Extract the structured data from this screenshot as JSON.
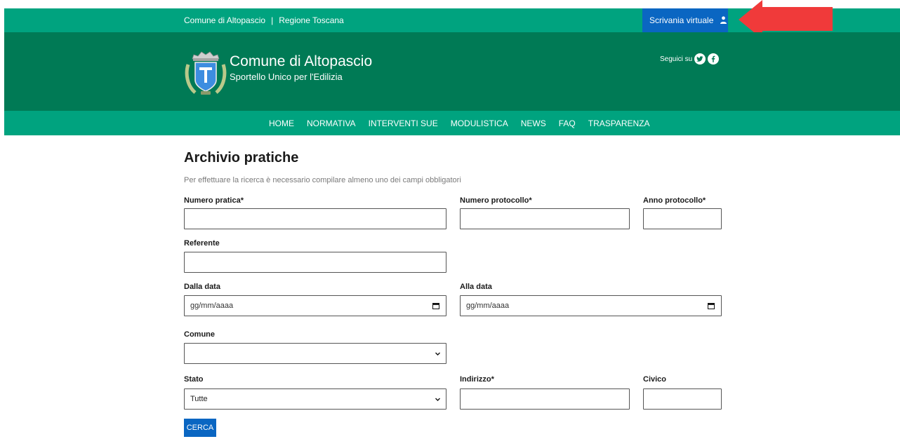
{
  "topbar": {
    "link_comune": "Comune di Altopascio",
    "separator": "|",
    "link_regione": "Regione Toscana",
    "scrivania_label": "Scrivania virtuale"
  },
  "header": {
    "title": "Comune di Altopascio",
    "subtitle": "Sportello Unico per l'Edilizia",
    "social_label": "Seguici su"
  },
  "nav": {
    "items": [
      "HOME",
      "NORMATIVA",
      "INTERVENTI SUE",
      "MODULISTICA",
      "NEWS",
      "FAQ",
      "TRASPARENZA"
    ]
  },
  "main": {
    "title": "Archivio pratiche",
    "hint": "Per effettuare la ricerca è necessario compilare almeno uno dei campi obbligatori",
    "labels": {
      "numero_pratica": "Numero pratica*",
      "numero_protocollo": "Numero protocollo*",
      "anno_protocollo": "Anno protocollo*",
      "referente": "Referente",
      "dalla_data": "Dalla data",
      "alla_data": "Alla data",
      "comune": "Comune",
      "stato": "Stato",
      "indirizzo": "Indirizzo*",
      "civico": "Civico"
    },
    "date_placeholder": "gg/mm/aaaa",
    "comune_value": "",
    "stato_value": "Tutte",
    "search_button": "CERCA"
  },
  "colors": {
    "primary_green": "#00a37f",
    "dark_green": "#007a55",
    "accent_blue": "#0a66c2",
    "annotation_red": "#f03a3a"
  }
}
